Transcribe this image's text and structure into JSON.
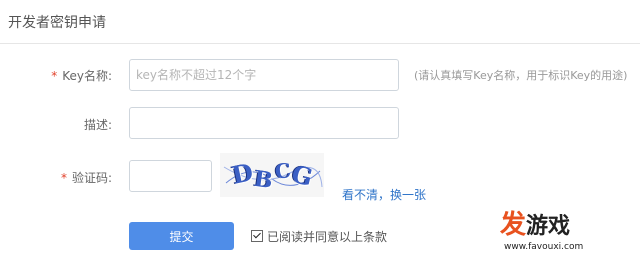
{
  "header": {
    "title": "开发者密钥申请"
  },
  "form": {
    "required_mark": "*",
    "key_name": {
      "label": "Key名称:",
      "placeholder": "key名称不超过12个字",
      "value": "",
      "hint": "(请认真填写Key名称，用于标识Key的用途)"
    },
    "description": {
      "label": "描述:",
      "value": ""
    },
    "captcha": {
      "label": "验证码:",
      "value": "",
      "image_text": "DBCG",
      "refresh_label": "看不清，换一张"
    },
    "submit_label": "提交",
    "agree": {
      "checked": true,
      "label": "已阅读并同意以上条款"
    }
  },
  "watermark": {
    "logo_main": "发",
    "logo_rest": "游戏",
    "url": "www.favouxi.com"
  },
  "colors": {
    "accent": "#4f8de8",
    "required": "#e2422b",
    "link": "#2f74c9",
    "watermark": "#e8521f"
  }
}
